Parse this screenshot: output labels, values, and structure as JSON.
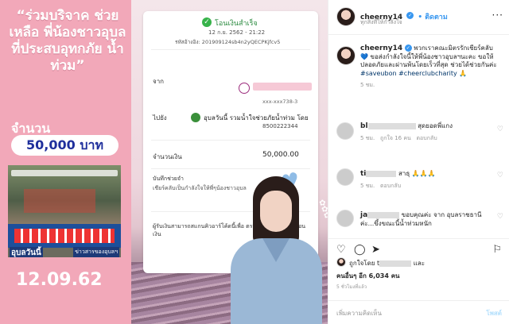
{
  "post_image": {
    "headline": "“ร่วมบริจาค ช่วยเหลือ พี่น้องชาวอุบล ที่ประสบอุทกภัย น้ำท่วม”",
    "amount_label": "จำนวน",
    "amount_value": "50,000 บาท",
    "flyer_logo": "อุบลวันนี้",
    "flyer_logo2": "ข่าวสารของอุบลฯ",
    "date": "12.09.62",
    "slip": {
      "title": "โอนเงินสำเร็จ",
      "date": "12 ก.ย. 2562 - 21:22",
      "ref": "รหัสอ้างอิง: 201909124sb4n2yQECPKjfcv5",
      "from_label": "จาก",
      "from_account": "xxx-xxx738-3",
      "to_label": "ไปยัง",
      "to_name": "อุบลวันนี้ รวมน้ำใจช่วยภัยน้ำท่วม โดย",
      "to_account": "8500222344",
      "amount_label": "จำนวนเงิน",
      "amount": "50,000.00",
      "memo_label": "บันทึกช่วยจำ",
      "memo": "เชียร์คลับเป็นกำลังใจให้พี่ๆน้องชาวอุบล",
      "note": "ผู้รับเงินสามารถสแกนคิวอาร์โค้ดนี้เพื่อ ตรวจสอบสถานะการโอนเงิน"
    }
  },
  "panel": {
    "username": "cheerny14",
    "follow_label": "• ติดตาม",
    "subtitle": "ทุกสิ่งที่ให้กำลังใจ",
    "caption_user": "cheerny14",
    "caption_text": "พวกเราคณะมิตรรักเชียร์คลับ💙 ขอส่งกำลังใจนี้ให้พี่น้องชาวอุบลฯนะคะ ขอให้ปลอดภัยและผ่านพ้นโดยเร็วที่สุด ช่วยได้ช่วยกันค่ะ",
    "caption_tags": "#saveubon #cheerclubcharity 🙏",
    "caption_time": "5 ชม.",
    "comments": [
      {
        "user": "bl",
        "text": "สุดยอดพี่แกง",
        "time": "5 ชม.",
        "likes": "ถูกใจ 16 คน",
        "reply": "ตอบกลับ"
      },
      {
        "user": "ti",
        "text": "สาธุ 🙏🙏🙏",
        "time": "5 ชม.",
        "likes": "",
        "reply": "ตอบกลับ"
      },
      {
        "user": "ja",
        "text": "ขอบคุณค่ะ จาก อุบลราชธานีค่ะ...ขึ้งขณะนี้น้ำท่วมหนัก",
        "time": "",
        "likes": "",
        "reply": ""
      }
    ],
    "liked_by": "ถูกใจโดย t",
    "liked_and": "และ",
    "liked_others": "คนอื่นๆ อีก 6,034 คน",
    "post_time": "5 ชั่วโมงที่แล้ว",
    "comment_placeholder": "เพิ่มความคิดเห็น",
    "post_button": "โพสต์"
  }
}
